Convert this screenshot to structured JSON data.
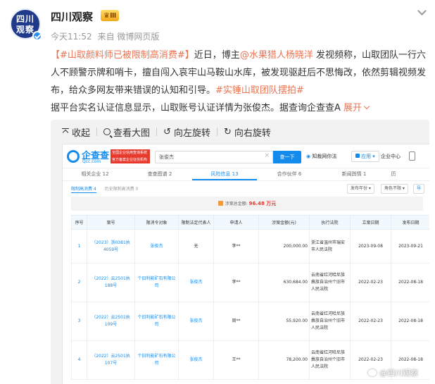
{
  "post": {
    "avatar_line1": "四川",
    "avatar_line2": "观察",
    "author": "四川观察",
    "badge": "Ⅲ",
    "time": "今天11:52",
    "source": "来自 微博网页版",
    "text": {
      "topic1": "【#山取颜料师已被限制高消费#】",
      "seg1": "近日，博主",
      "mention": "@水果猎人杨晓洋",
      "seg2": " 发视频称，山取团队一行六人不顾警示牌和哨卡，擅自闯入哀牢山马鞍山水库，被发现驱赶后不思悔改，依然剪辑视频发布，给众多网友带来错误的认知和引导。",
      "topic2": "#实锤山取团队摆拍#",
      "seg3": "据平台实名认证信息显示，山取账号认证详情为张俊杰。据查询企查查A",
      "expand": "展开"
    }
  },
  "viewer": {
    "collapse": "收起",
    "view_large": "查看大图",
    "rotate_left": "向左旋转",
    "rotate_right": "向右旋转"
  },
  "qcc": {
    "logo": "企查查",
    "logo_sub": "Qcc.com",
    "ad": "全国企业信用查询系统 官方备案企业征信机构",
    "search_value": "张俊杰",
    "search_btn": "查一下",
    "link_risk": "知裁网你法",
    "app_btn": "应用",
    "link_enterprise": "企业中心",
    "tabs": [
      "相关企业 12",
      "查查图谱 2",
      "风险信息 13",
      "合作伙伴 6",
      "新闻舆情 1",
      "历"
    ],
    "active_tab": 2,
    "subtab_on": "限制高消费 4",
    "subtab_off": "历史限制高消费 0",
    "sel1": "发布年份",
    "sel2": "角色不限",
    "sel3": "导",
    "banner_label": "涉案总金额:",
    "banner_value": "96.48 万元",
    "headers": [
      "序号",
      "案号",
      "限消令对象",
      "限制法定代表人",
      "申请人",
      "涉案金额(元)",
      "执行法院",
      "立案日期",
      "发布日期"
    ],
    "rows": [
      [
        "1",
        "（2023）浙0381执4059号",
        "张俊杰",
        "无",
        "李**",
        "200,000.00",
        "浙江省温州市瑞安市人民法院",
        "2023-09-08",
        "2023-09-21"
      ],
      [
        "2",
        "（2022）云2501执188号",
        "个旧利能矿石有限公司",
        "张俊杰",
        "李**",
        "630,684.00",
        "云南省红河哈尼族彝族自治州个旧市人民法院",
        "2022-02-23",
        "2022-08-18"
      ],
      [
        "3",
        "（2022）云2501执109号",
        "个旧利能矿石有限公司",
        "张俊杰",
        "周**",
        "55,920.00",
        "云南省红河哈尼族彝族自治州个旧市人民法院",
        "2022-02-23",
        "2022-08-18"
      ],
      [
        "4",
        "（2022）云2501执107号",
        "个旧利能矿石有限公司",
        "张俊杰",
        "王**",
        "78,200.00",
        "云南省红河哈尼族彝族自治州个旧市人民法院",
        "2022-02-23",
        "2022-08-18"
      ]
    ]
  },
  "watermark": "@四川观察"
}
